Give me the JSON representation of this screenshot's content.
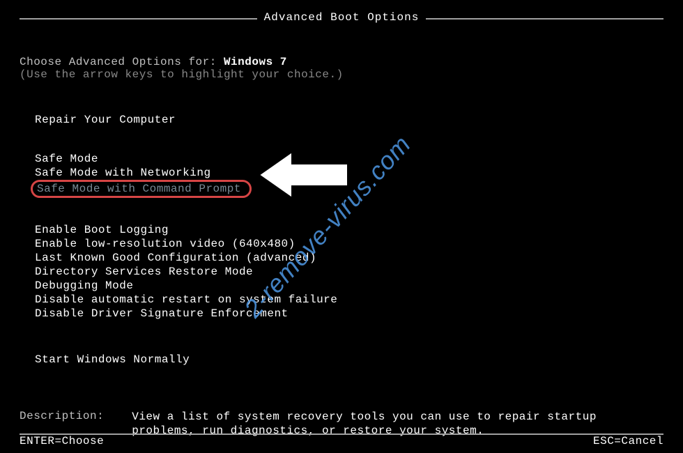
{
  "title": "Advanced Boot Options",
  "instruction": {
    "prefix": "Choose Advanced Options for: ",
    "os": "Windows 7",
    "hint": "(Use the arrow keys to highlight your choice.)"
  },
  "menu": {
    "group1": [
      "Repair Your Computer"
    ],
    "group2": [
      "Safe Mode",
      "Safe Mode with Networking",
      "Safe Mode with Command Prompt"
    ],
    "group3": [
      "Enable Boot Logging",
      "Enable low-resolution video (640x480)",
      "Last Known Good Configuration (advanced)",
      "Directory Services Restore Mode",
      "Debugging Mode",
      "Disable automatic restart on system failure",
      "Disable Driver Signature Enforcement"
    ],
    "group4": [
      "Start Windows Normally"
    ]
  },
  "description": {
    "label": "Description:",
    "text": "View a list of system recovery tools you can use to repair startup problems, run diagnostics, or restore your system."
  },
  "footer": {
    "left": "ENTER=Choose",
    "right": "ESC=Cancel"
  },
  "watermark": "2-remove-virus.com"
}
